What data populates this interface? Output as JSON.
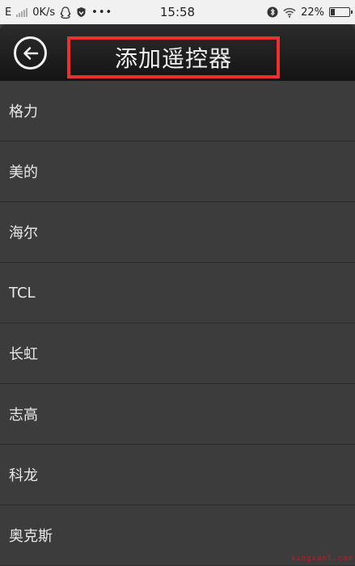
{
  "status_bar": {
    "carrier": "E",
    "network_speed": "0K/s",
    "time": "15:58",
    "battery_percent": "22%",
    "battery_level": 0.22,
    "icons": [
      "signal-icon",
      "qq-icon",
      "shield-icon",
      "more-dots-icon",
      "bluetooth-icon",
      "wifi-icon",
      "battery-icon"
    ]
  },
  "header": {
    "title": "添加遥控器",
    "back_icon": "back-arrow-icon",
    "highlight_color": "#ea3030"
  },
  "brands": [
    "格力",
    "美的",
    "海尔",
    "TCL",
    "长虹",
    "志高",
    "科龙",
    "奥克斯"
  ],
  "watermark": "xingxanl.com"
}
